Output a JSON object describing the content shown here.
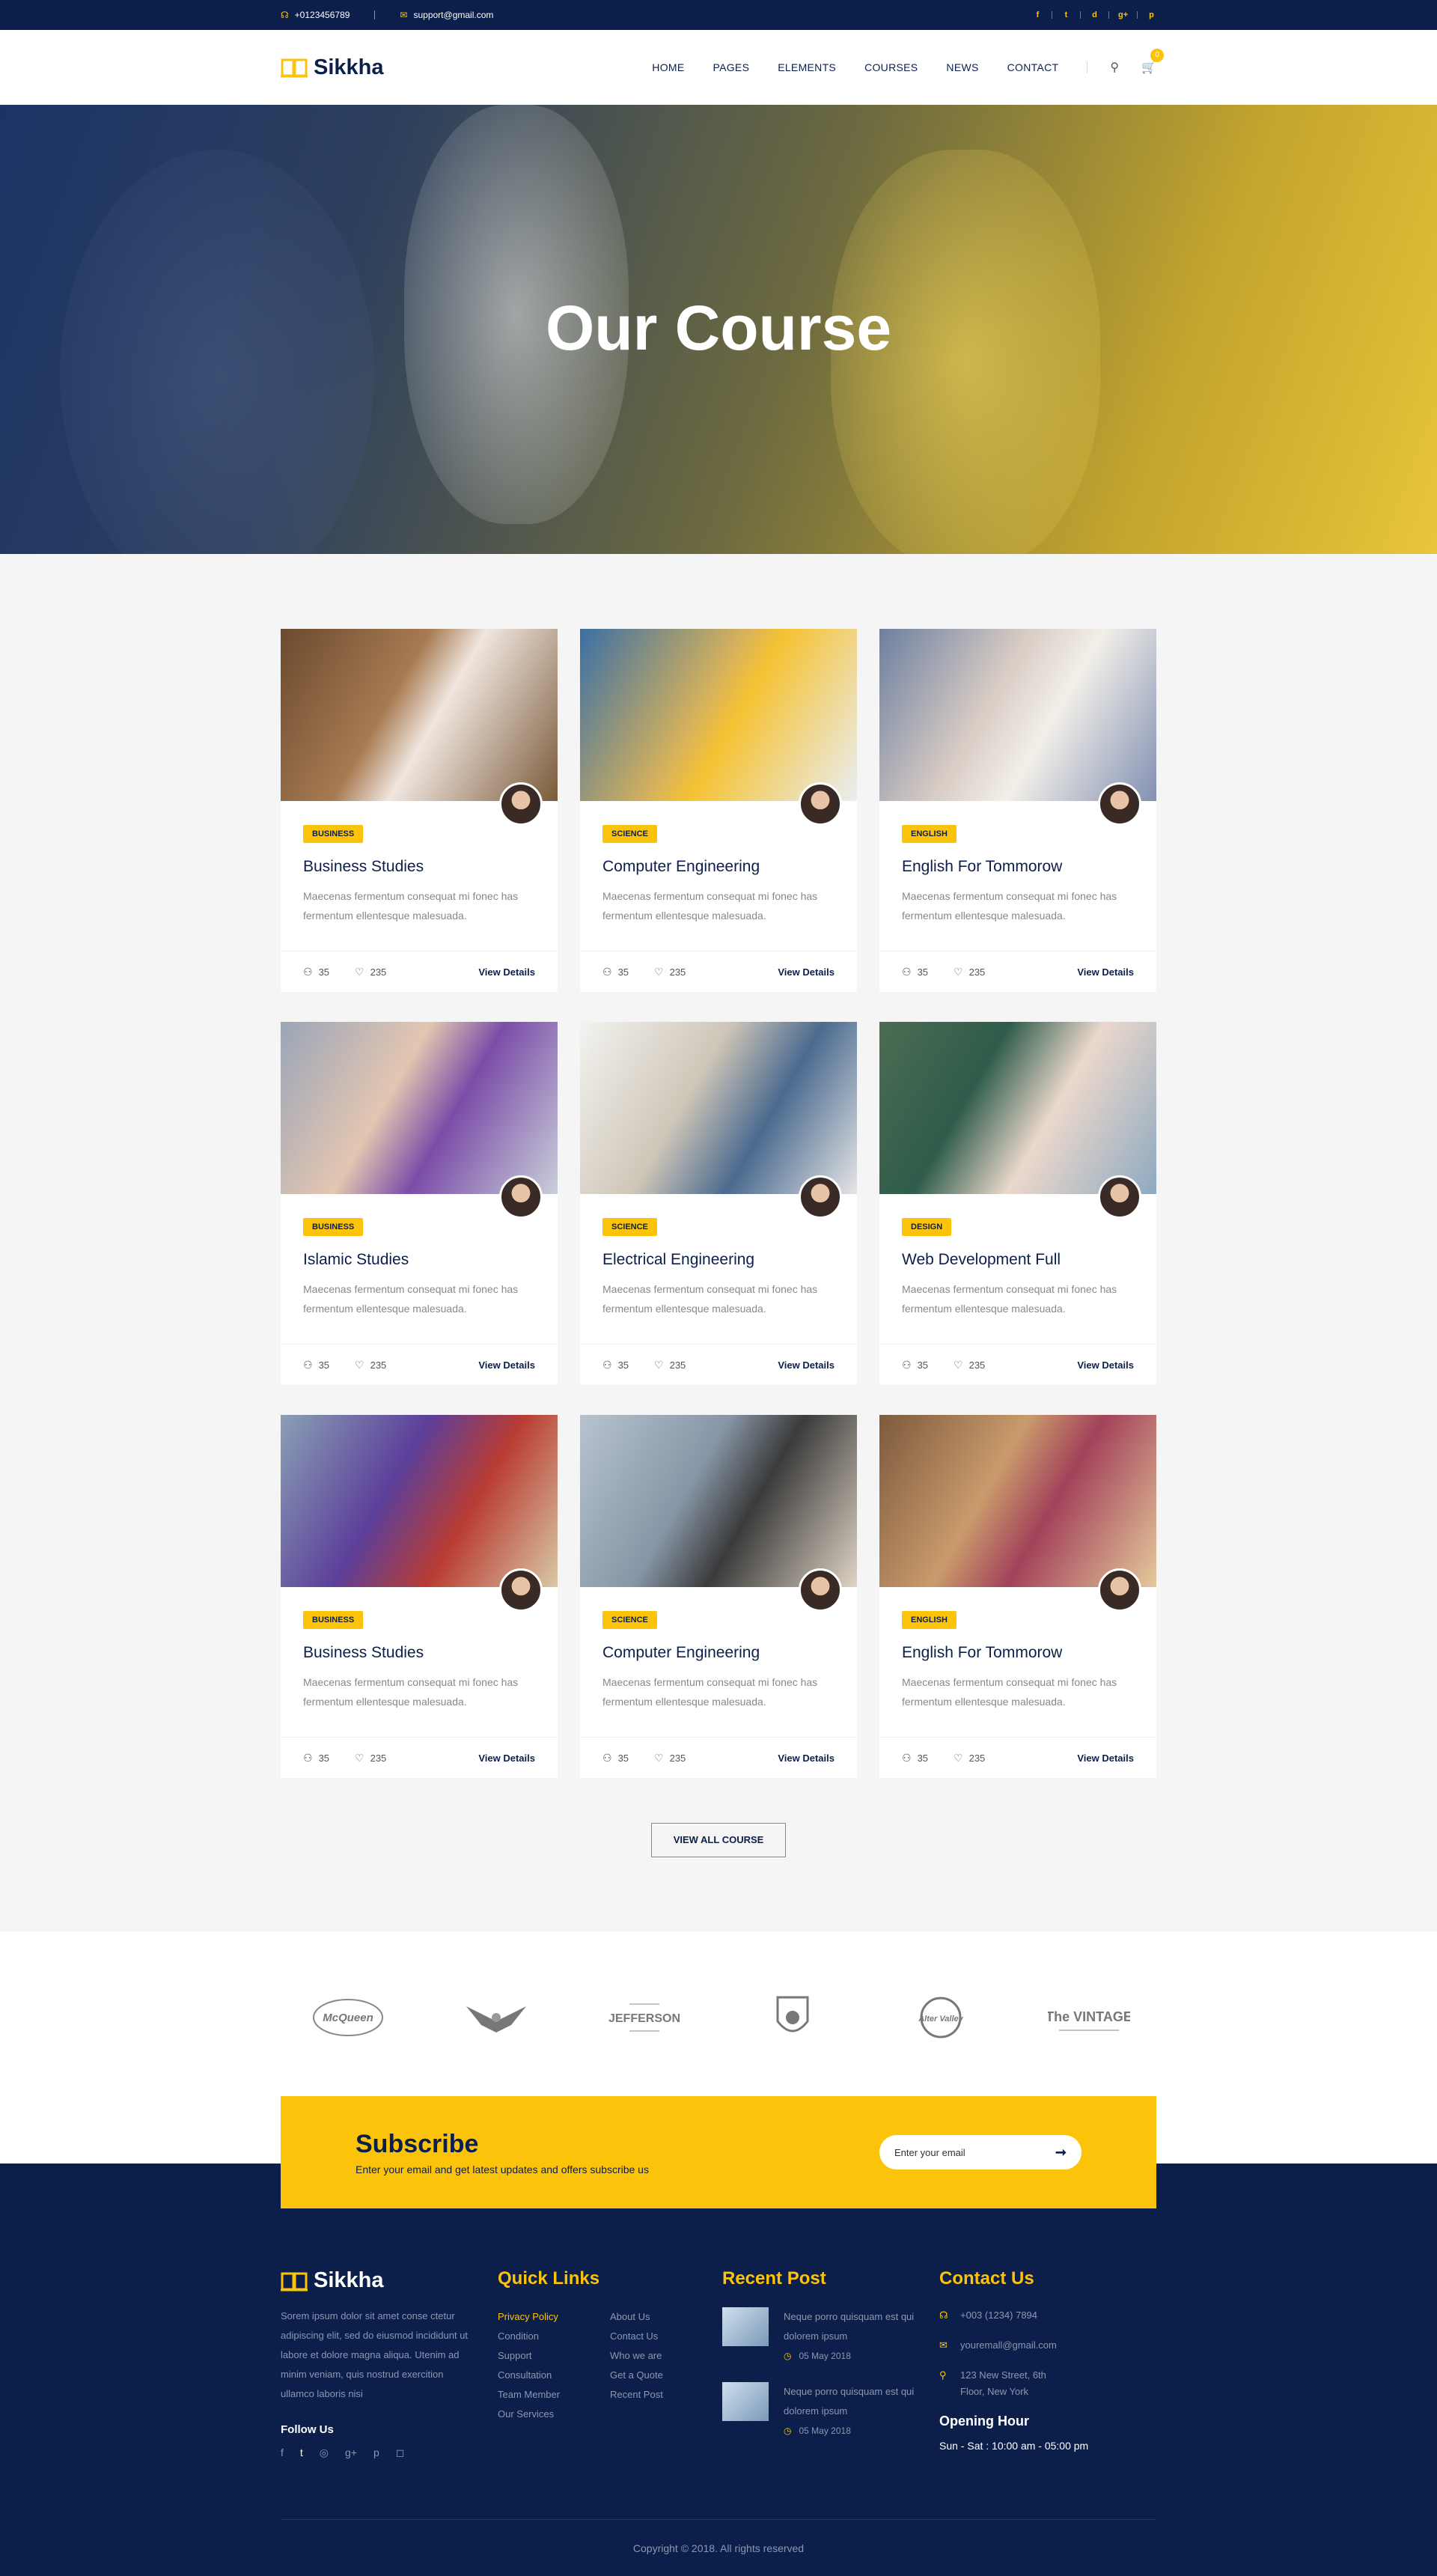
{
  "topbar": {
    "phone": "+0123456789",
    "email": "support@gmail.com",
    "social": [
      "f",
      "t",
      "d",
      "g+",
      "p"
    ]
  },
  "header": {
    "logo": "Sikkha",
    "nav": [
      "HOME",
      "PAGES",
      "ELEMENTS",
      "COURSES",
      "NEWS",
      "CONTACT"
    ],
    "cart_count": "0"
  },
  "hero": {
    "title": "Our Course"
  },
  "courses": [
    {
      "category": "BUSINESS",
      "title": "Business Studies",
      "desc": "Maecenas fermentum consequat mi fonec has fermentum ellentesque malesuada.",
      "students": "35",
      "likes": "235",
      "link": "View Details"
    },
    {
      "category": "SCIENCE",
      "title": "Computer Engineering",
      "desc": "Maecenas fermentum consequat mi fonec has fermentum ellentesque malesuada.",
      "students": "35",
      "likes": "235",
      "link": "View Details"
    },
    {
      "category": "ENGLISH",
      "title": "English For Tommorow",
      "desc": "Maecenas fermentum consequat mi fonec has fermentum ellentesque malesuada.",
      "students": "35",
      "likes": "235",
      "link": "View Details"
    },
    {
      "category": "BUSINESS",
      "title": "Islamic Studies",
      "desc": "Maecenas fermentum consequat mi fonec has fermentum ellentesque malesuada.",
      "students": "35",
      "likes": "235",
      "link": "View Details"
    },
    {
      "category": "SCIENCE",
      "title": "Electrical Engineering",
      "desc": "Maecenas fermentum consequat mi fonec has fermentum ellentesque malesuada.",
      "students": "35",
      "likes": "235",
      "link": "View Details"
    },
    {
      "category": "DESIGN",
      "title": "Web Development Full",
      "desc": "Maecenas fermentum consequat mi fonec has fermentum ellentesque malesuada.",
      "students": "35",
      "likes": "235",
      "link": "View Details"
    },
    {
      "category": "BUSINESS",
      "title": "Business Studies",
      "desc": "Maecenas fermentum consequat mi fonec has fermentum ellentesque malesuada.",
      "students": "35",
      "likes": "235",
      "link": "View Details"
    },
    {
      "category": "SCIENCE",
      "title": "Computer Engineering",
      "desc": "Maecenas fermentum consequat mi fonec has fermentum ellentesque malesuada.",
      "students": "35",
      "likes": "235",
      "link": "View Details"
    },
    {
      "category": "ENGLISH",
      "title": "English For Tommorow",
      "desc": "Maecenas fermentum consequat mi fonec has fermentum ellentesque malesuada.",
      "students": "35",
      "likes": "235",
      "link": "View Details"
    }
  ],
  "view_all": "VIEW ALL COURSE",
  "brands": [
    "McQueen",
    "Eagle",
    "JEFFERSON",
    "Football",
    "Alter Valley",
    "The VINTAGE"
  ],
  "subscribe": {
    "title": "Subscribe",
    "text": "Enter  your email and get latest updates and offers subscribe us",
    "placeholder": "Enter your email"
  },
  "footer": {
    "logo": "Sikkha",
    "about": "Sorem ipsum dolor sit amet conse ctetur adipiscing elit, sed do eiusmod  incididunt ut labore et dolore magna aliqua. Utenim ad minim veniam, quis nostrud exercition ullamco laboris nisi",
    "follow": "Follow Us",
    "quick_links_title": "Quick Links",
    "links_a": [
      "Privacy Policy",
      "Condition",
      "Support",
      "Consultation",
      "Team Member",
      "Our Services"
    ],
    "links_b": [
      "About Us",
      "Contact Us",
      "Who we are",
      "Get a Quote",
      "Recent Post"
    ],
    "recent_title": "Recent Post",
    "posts": [
      {
        "text": "Neque porro quisquam est qui dolorem ipsum",
        "date": "05 May 2018"
      },
      {
        "text": "Neque porro quisquam est qui dolorem ipsum",
        "date": "05 May 2018"
      }
    ],
    "contact_title": "Contact Us",
    "phone": "+003 (1234) 7894",
    "email": "youremall@gmail.com",
    "address": "123 New Street, 6th Floor, New York",
    "opening_title": "Opening Hour",
    "opening": "Sun - Sat : 10:00 am - 05:00 pm",
    "copyright": "Copyright © 2018. All rights reserved"
  },
  "colors": {
    "navy": "#0c1f4b",
    "yellow": "#fcc30b"
  }
}
